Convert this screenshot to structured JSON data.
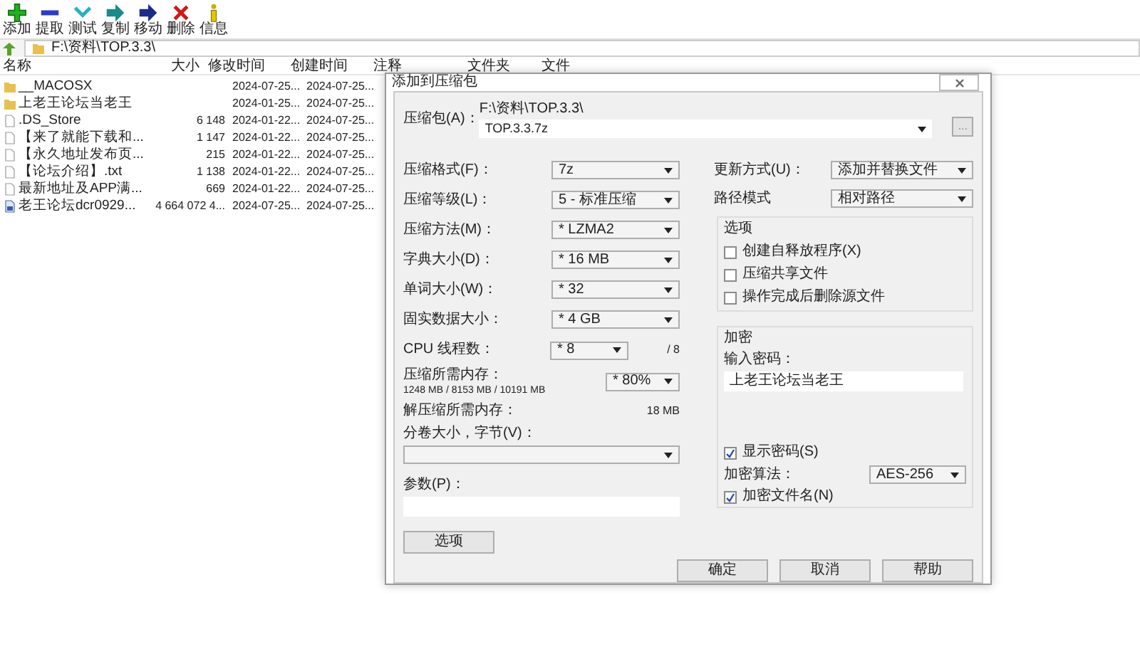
{
  "toolbar": [
    {
      "label": "添加",
      "kind": "add"
    },
    {
      "label": "提取",
      "kind": "extract"
    },
    {
      "label": "测试",
      "kind": "test"
    },
    {
      "label": "复制",
      "kind": "copy"
    },
    {
      "label": "移动",
      "kind": "move"
    },
    {
      "label": "删除",
      "kind": "delete"
    },
    {
      "label": "信息",
      "kind": "info"
    }
  ],
  "address": "F:\\资料\\TOP.3.3\\",
  "columns": [
    "名称",
    "大小",
    "修改时间",
    "创建时间",
    "注释",
    "文件夹",
    "文件"
  ],
  "rows": [
    {
      "kind": "folder",
      "name": "__MACOSX",
      "size": "",
      "modified": "2024-07-25...",
      "created": "2024-07-25..."
    },
    {
      "kind": "folder",
      "name": "上老王论坛当老王",
      "size": "",
      "modified": "2024-01-25...",
      "created": "2024-07-25..."
    },
    {
      "kind": "file",
      "name": ".DS_Store",
      "size": "6 148",
      "modified": "2024-01-22...",
      "created": "2024-07-25..."
    },
    {
      "kind": "file",
      "name": "【来了就能下载和...",
      "size": "1 147",
      "modified": "2024-01-22...",
      "created": "2024-07-25..."
    },
    {
      "kind": "file",
      "name": "【永久地址发布页...",
      "size": "215",
      "modified": "2024-01-22...",
      "created": "2024-07-25..."
    },
    {
      "kind": "file",
      "name": "【论坛介绍】.txt",
      "size": "1 138",
      "modified": "2024-01-22...",
      "created": "2024-07-25..."
    },
    {
      "kind": "file",
      "name": "最新地址及APP满...",
      "size": "669",
      "modified": "2024-01-22...",
      "created": "2024-07-25..."
    },
    {
      "kind": "archive",
      "name": "老王论坛dcr0929...",
      "size": "4 664 072 4...",
      "modified": "2024-07-25...",
      "created": "2024-07-25..."
    }
  ],
  "dialog": {
    "title": "添加到压缩包",
    "archive": {
      "label": "压缩包(A)：",
      "path": "F:\\资料\\TOP.3.3\\",
      "value": "TOP.3.3.7z",
      "browse": "..."
    },
    "settings": [
      {
        "label": "压缩格式(F)：",
        "value": "7z"
      },
      {
        "label": "压缩等级(L)：",
        "value": "5 - 标准压缩"
      },
      {
        "label": "压缩方法(M)：",
        "value": "* LZMA2"
      },
      {
        "label": "字典大小(D)：",
        "value": "* 16 MB"
      },
      {
        "label": "单词大小(W)：",
        "value": "* 32"
      },
      {
        "label": "固实数据大小：",
        "value": "* 4 GB"
      }
    ],
    "cpu": {
      "label": "CPU 线程数：",
      "value": "* 8",
      "max": "/ 8"
    },
    "memory": {
      "label": "压缩所需内存：",
      "detail": "1248 MB / 8153 MB / 10191 MB",
      "value": "* 80%"
    },
    "decompress": {
      "label": "解压缩所需内存：",
      "value": "18 MB"
    },
    "volume": {
      "label": "分卷大小，字节(V)："
    },
    "params": {
      "label": "参数(P)："
    },
    "options_button": "选项",
    "update": {
      "label": "更新方式(U)：",
      "value": "添加并替换文件"
    },
    "path_mode": {
      "label": "路径模式",
      "value": "相对路径"
    },
    "options": {
      "title": "选项",
      "items": [
        {
          "label": "创建自释放程序(X)",
          "checked": false
        },
        {
          "label": "压缩共享文件",
          "checked": false
        },
        {
          "label": "操作完成后删除源文件",
          "checked": false
        }
      ]
    },
    "encryption": {
      "title": "加密",
      "password_label": "输入密码：",
      "password": "上老王论坛当老王",
      "show_password": {
        "label": "显示密码(S)",
        "checked": true
      },
      "method_label": "加密算法：",
      "method": "AES-256",
      "encrypt_names": {
        "label": "加密文件名(N)",
        "checked": true
      }
    },
    "buttons": [
      "确定",
      "取消",
      "帮助"
    ]
  }
}
